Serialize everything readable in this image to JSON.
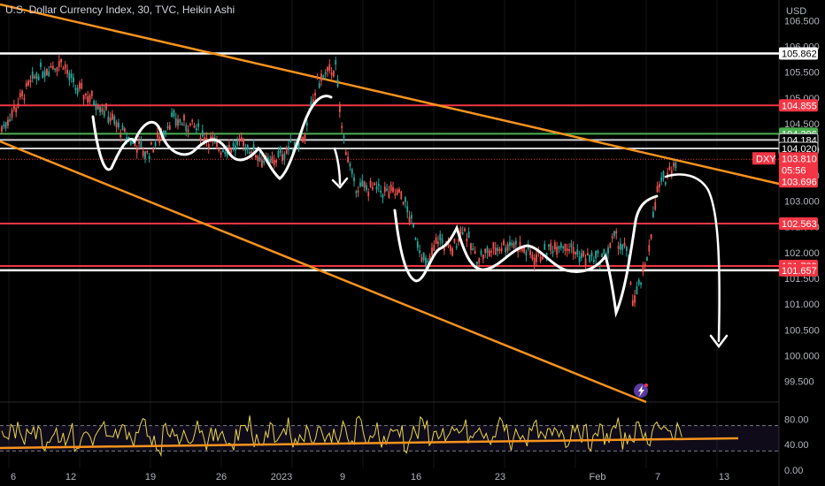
{
  "header": {
    "title": "U.S. Dollar Currency Index, 30, TVC, Heikin Ashi"
  },
  "currency_label": "USD",
  "chart_data": {
    "type": "line",
    "symbol": "DXY",
    "title": "U.S. Dollar Currency Index, 30, TVC, Heikin Ashi",
    "price_axis": {
      "ticks": [
        "106.500",
        "106.000",
        "105.500",
        "105.000",
        "104.500",
        "104.000",
        "103.500",
        "103.000",
        "102.500",
        "102.000",
        "101.500",
        "101.000",
        "100.500",
        "100.000",
        "99.500"
      ],
      "range": [
        99.1,
        106.9
      ]
    },
    "time_axis": {
      "labels": [
        "6",
        "12",
        "19",
        "26",
        "2023",
        "9",
        "16",
        "23",
        "Feb",
        "7",
        "13"
      ]
    },
    "horizontal_levels": [
      {
        "value": 105.862,
        "label": "105.862",
        "color": "#ffffff",
        "tag_bg": "#ffffff",
        "tag_fg": "#000000"
      },
      {
        "value": 104.855,
        "label": "104.855",
        "color": "#f23645",
        "tag_bg": "#f23645",
        "tag_fg": "#ffffff"
      },
      {
        "value": 104.306,
        "label": "104.306",
        "color": "#4caf50",
        "tag_bg": "#4caf50",
        "tag_fg": "#ffffff"
      },
      {
        "value": 104.184,
        "label": "104.184",
        "color": "#cfcfcf",
        "tag_bg": "#000000",
        "tag_fg": "#ffffff"
      },
      {
        "value": 104.02,
        "label": "104.020",
        "color": "#cfcfcf",
        "tag_bg": "#000000",
        "tag_fg": "#ffffff"
      },
      {
        "value": 102.563,
        "label": "102.563",
        "color": "#f23645",
        "tag_bg": "#f23645",
        "tag_fg": "#ffffff"
      },
      {
        "value": 101.739,
        "label": "101.739",
        "color": "#f23645",
        "tag_bg": "#f23645",
        "tag_fg": "#ffffff"
      },
      {
        "value": 101.657,
        "label": "101.657",
        "color": "#ffffff",
        "tag_bg": "#f23645",
        "tag_fg": "#ffffff"
      }
    ],
    "current_price": {
      "symbol": "DXY",
      "price": "103.810",
      "countdown": "05:56",
      "prev": "103.696",
      "color": "#f23645"
    },
    "price_path": [
      [
        0,
        104.4
      ],
      [
        3,
        105.5
      ],
      [
        5,
        105.7
      ],
      [
        6,
        105.2
      ],
      [
        8,
        104.9
      ],
      [
        10,
        104.3
      ],
      [
        12,
        103.9
      ],
      [
        14,
        104.6
      ],
      [
        16,
        104.4
      ],
      [
        18,
        104.0
      ],
      [
        20,
        104.1
      ],
      [
        22,
        103.7
      ],
      [
        25,
        104.3
      ],
      [
        26,
        105.3
      ],
      [
        27.5,
        105.6
      ],
      [
        28,
        104.4
      ],
      [
        29,
        103.3
      ],
      [
        31,
        103.2
      ],
      [
        33,
        103.1
      ],
      [
        34,
        102.4
      ],
      [
        35,
        101.7
      ],
      [
        36,
        102.3
      ],
      [
        37,
        102.0
      ],
      [
        38,
        102.5
      ],
      [
        39,
        101.9
      ],
      [
        40,
        102.0
      ],
      [
        42,
        102.2
      ],
      [
        44,
        101.9
      ],
      [
        46,
        102.2
      ],
      [
        48,
        101.9
      ],
      [
        49.5,
        101.9
      ],
      [
        50.5,
        102.3
      ],
      [
        51.5,
        102.0
      ],
      [
        52,
        101.0
      ],
      [
        53,
        101.7
      ],
      [
        54,
        103.2
      ],
      [
        55.5,
        103.8
      ]
    ],
    "drawn_trendlines": "orange descending channel",
    "rsi": {
      "ticks": [
        "80.00",
        "40.00",
        "0.00"
      ],
      "levels": [
        70,
        30
      ],
      "values": [
        55,
        62,
        48,
        70,
        58,
        45,
        66,
        52,
        60,
        40,
        58,
        50,
        68,
        44,
        56,
        62,
        47,
        72,
        54,
        38,
        60,
        66,
        49,
        57,
        70,
        45,
        52,
        63,
        41,
        58,
        74,
        50,
        46,
        61,
        55,
        68,
        43,
        59,
        52,
        65,
        48,
        57,
        62,
        45,
        72,
        51,
        66,
        47,
        55,
        63,
        40,
        58,
        69,
        52,
        60,
        44,
        57,
        66,
        50,
        61,
        48,
        56,
        74,
        43,
        59,
        52,
        64,
        47,
        55,
        62,
        49,
        70,
        57,
        45,
        61,
        53,
        68,
        46,
        58,
        63,
        50,
        72,
        55,
        60,
        65
      ],
      "line_color": "#e8d44d"
    }
  }
}
